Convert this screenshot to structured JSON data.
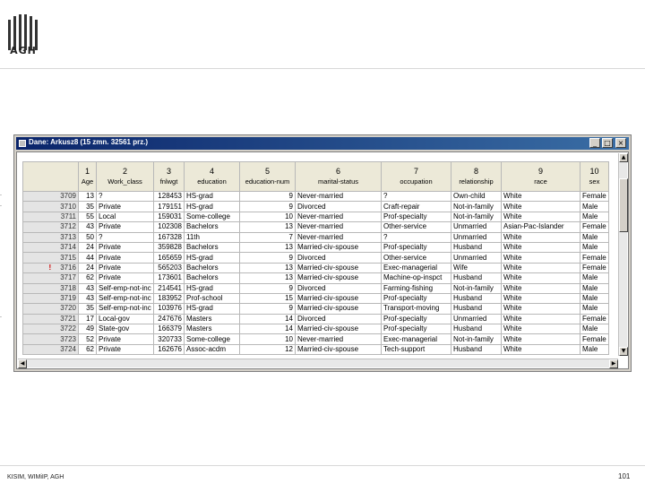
{
  "slide": {
    "logo_text": "AGH",
    "footer_left": "KISIM, WIMiIP, AGH",
    "page_number": "101"
  },
  "window": {
    "title": "Dane: Arkusz8 (15 zmn. 32561 prz.)",
    "buttons": {
      "minimize": "_",
      "maximize": "□",
      "close": "×"
    }
  },
  "grid": {
    "columns": [
      {
        "num": "1",
        "name": "Age"
      },
      {
        "num": "2",
        "name": "Work_class"
      },
      {
        "num": "3",
        "name": "fnlwgt"
      },
      {
        "num": "4",
        "name": "education"
      },
      {
        "num": "5",
        "name": "education-num"
      },
      {
        "num": "6",
        "name": "marital-status"
      },
      {
        "num": "7",
        "name": "occupation"
      },
      {
        "num": "8",
        "name": "relationship"
      },
      {
        "num": "9",
        "name": "race"
      },
      {
        "num": "10",
        "name": "sex"
      }
    ],
    "rows": [
      {
        "id": "3709",
        "age": "13",
        "work": "?",
        "fnlwgt": "128453",
        "edu": "HS-grad",
        "edunum": "9",
        "marital": "Never-married",
        "occ": "?",
        "rel": "Own-child",
        "race": "White",
        "sex": "Female",
        "mark": "."
      },
      {
        "id": "3710",
        "age": "35",
        "work": "Private",
        "fnlwgt": "179151",
        "edu": "HS-grad",
        "edunum": "9",
        "marital": "Divorced",
        "occ": "Craft-repair",
        "rel": "Not-in-family",
        "race": "White",
        "sex": "Male",
        "mark": "."
      },
      {
        "id": "3711",
        "age": "55",
        "work": "Local",
        "fnlwgt": "159031",
        "edu": "Some-college",
        "edunum": "10",
        "marital": "Never-married",
        "occ": "Prof-specialty",
        "rel": "Not-in-family",
        "race": "White",
        "sex": "Male",
        "mark": ""
      },
      {
        "id": "3712",
        "age": "43",
        "work": "Private",
        "fnlwgt": "102308",
        "edu": "Bachelors",
        "edunum": "13",
        "marital": "Never-married",
        "occ": "Other-service",
        "rel": "Unmarried",
        "race": "Asian-Pac-Islander",
        "sex": "Female",
        "mark": ""
      },
      {
        "id": "3713",
        "age": "50",
        "work": "?",
        "fnlwgt": "167328",
        "edu": "11th",
        "edunum": "7",
        "marital": "Never-married",
        "occ": "?",
        "rel": "Unmarried",
        "race": "White",
        "sex": "Male",
        "mark": ""
      },
      {
        "id": "3714",
        "age": "24",
        "work": "Private",
        "fnlwgt": "359828",
        "edu": "Bachelors",
        "edunum": "13",
        "marital": "Married-civ-spouse",
        "occ": "Prof-specialty",
        "rel": "Husband",
        "race": "White",
        "sex": "Male",
        "mark": ""
      },
      {
        "id": "3715",
        "age": "44",
        "work": "Private",
        "fnlwgt": "165659",
        "edu": "HS-grad",
        "edunum": "9",
        "marital": "Divorced",
        "occ": "Other-service",
        "rel": "Unmarried",
        "race": "White",
        "sex": "Female",
        "mark": ""
      },
      {
        "id": "3716",
        "age": "24",
        "work": "Private",
        "fnlwgt": "565203",
        "edu": "Bachelors",
        "edunum": "13",
        "marital": "Married-civ-spouse",
        "occ": "Exec-managerial",
        "rel": "Wife",
        "race": "White",
        "sex": "Female",
        "mark": "",
        "warn": "!"
      },
      {
        "id": "3717",
        "age": "62",
        "work": "Private",
        "fnlwgt": "173601",
        "edu": "Bachelors",
        "edunum": "13",
        "marital": "Married-civ-spouse",
        "occ": "Machine-op-inspct",
        "rel": "Husband",
        "race": "White",
        "sex": "Male",
        "mark": ""
      },
      {
        "id": "3718",
        "age": "43",
        "work": "Self-emp-not-inc",
        "fnlwgt": "214541",
        "edu": "HS-grad",
        "edunum": "9",
        "marital": "Divorced",
        "occ": "Farming-fishing",
        "rel": "Not-in-family",
        "race": "White",
        "sex": "Male",
        "mark": ""
      },
      {
        "id": "3719",
        "age": "43",
        "work": "Self-emp-not-inc",
        "fnlwgt": "183952",
        "edu": "Prof-school",
        "edunum": "15",
        "marital": "Married-civ-spouse",
        "occ": "Prof-specialty",
        "rel": "Husband",
        "race": "White",
        "sex": "Male",
        "mark": ""
      },
      {
        "id": "3720",
        "age": "35",
        "work": "Self-emp-not-inc",
        "fnlwgt": "103976",
        "edu": "HS-grad",
        "edunum": "9",
        "marital": "Married-civ-spouse",
        "occ": "Transport-moving",
        "rel": "Husband",
        "race": "White",
        "sex": "Male",
        "mark": "."
      },
      {
        "id": "3721",
        "age": "17",
        "work": "Local-gov",
        "fnlwgt": "247676",
        "edu": "Masters",
        "edunum": "14",
        "marital": "Divorced",
        "occ": "Prof-specialty",
        "rel": "Unmarried",
        "race": "White",
        "sex": "Female",
        "mark": ""
      },
      {
        "id": "3722",
        "age": "49",
        "work": "State-gov",
        "fnlwgt": "166379",
        "edu": "Masters",
        "edunum": "14",
        "marital": "Married-civ-spouse",
        "occ": "Prof-specialty",
        "rel": "Husband",
        "race": "White",
        "sex": "Male",
        "mark": ""
      },
      {
        "id": "3723",
        "age": "52",
        "work": "Private",
        "fnlwgt": "320733",
        "edu": "Some-college",
        "edunum": "10",
        "marital": "Never-married",
        "occ": "Exec-managerial",
        "rel": "Not-in-family",
        "race": "White",
        "sex": "Female",
        "mark": ""
      },
      {
        "id": "3724",
        "age": "62",
        "work": "Private",
        "fnlwgt": "162676",
        "edu": "Assoc-acdm",
        "edunum": "12",
        "marital": "Married-civ-spouse",
        "occ": "Tech-support",
        "rel": "Husband",
        "race": "White",
        "sex": "Male",
        "mark": ""
      }
    ]
  },
  "colors": {
    "titlebar": "#0a246a",
    "highlight": "#8b5a1e",
    "warn": "#d00000"
  }
}
